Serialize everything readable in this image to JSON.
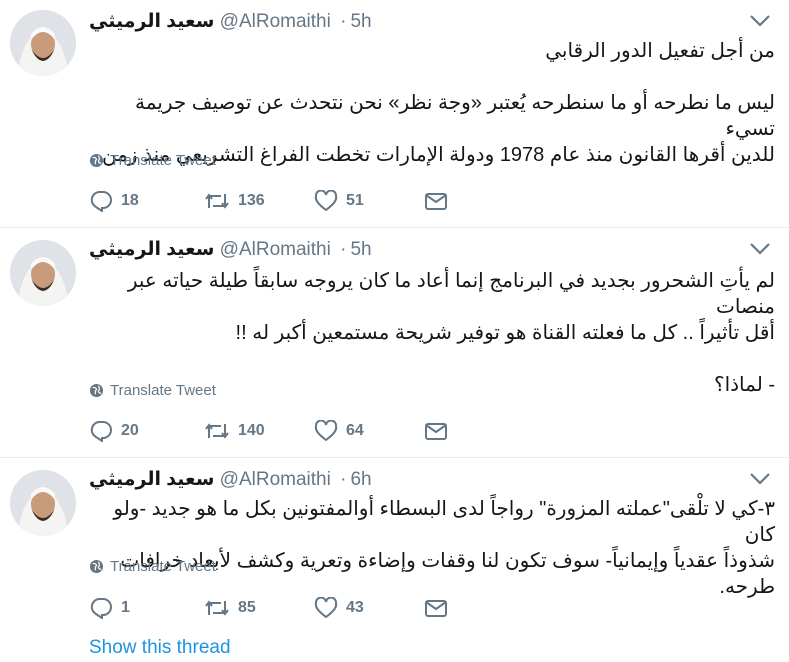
{
  "tweets": [
    {
      "name": "سعيد الرميثي",
      "handle": "@AlRomaithi",
      "time": "5h",
      "lines": [
        "من أجل تفعيل الدور الرقابي",
        "",
        "ليس ما نطرحه أو ما سنطرحه يُعتبر «وجة نظر» نحن نتحدث عن توصيف جريمة تسيء",
        "للدين أقرها القانون منذ عام 1978 ودولة الإمارات تخطت الفراغ التشريعي منذ زمن."
      ],
      "translate": "Translate Tweet",
      "replies": "18",
      "retweets": "136",
      "likes": "51"
    },
    {
      "name": "سعيد الرميثي",
      "handle": "@AlRomaithi",
      "time": "5h",
      "lines": [
        "لم يأتِ الشحرور بجديد في البرنامج إنما أعاد ما كان يروجه سابقاً طيلة حياته عبر منصات",
        "أقل تأثيراً .. كل ما فعلته القناة هو توفير شريحة مستمعين أكبر له !!",
        "",
        "- لماذا؟"
      ],
      "translate": "Translate Tweet",
      "replies": "20",
      "retweets": "140",
      "likes": "64"
    },
    {
      "name": "سعيد الرميثي",
      "handle": "@AlRomaithi",
      "time": "6h",
      "lines": [
        "٣-كي لا تلْقى\"عملته المزورة\" رواجاً لدى البسطاء أوالمفتونين بكل ما هو جديد -ولو كان",
        "شذوذاً عقدياً وإيمانياً- سوف تكون لنا وقفات وإضاءة وتعرية وكشف لأبعاد خرافات طرحه."
      ],
      "translate": "Translate Tweet",
      "replies": "1",
      "retweets": "85",
      "likes": "43"
    }
  ],
  "show_thread": "Show this thread",
  "colors": {
    "muted": "#657786",
    "link": "#1b95e0",
    "text": "#14171a",
    "divider": "#e6ecf0"
  }
}
